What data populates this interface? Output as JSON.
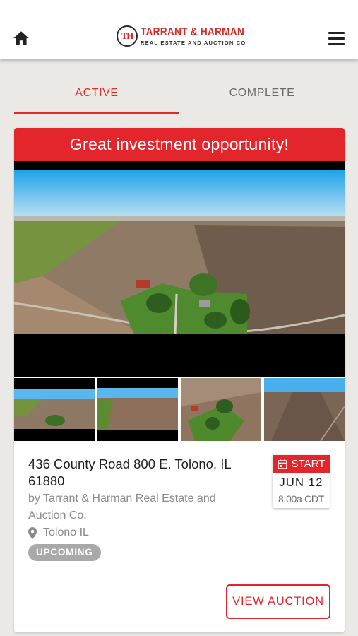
{
  "header": {
    "logo": {
      "monogram": "TH",
      "name": "TARRANT & HARMAN",
      "tagline": "REAL ESTATE AND AUCTION CO"
    },
    "icons": {
      "home": "home-icon",
      "menu": "hamburger-menu-icon"
    }
  },
  "tabs": [
    {
      "label": "ACTIVE",
      "selected": true
    },
    {
      "label": "COMPLETE",
      "selected": false
    }
  ],
  "listing": {
    "banner": "Great investment opportunity!",
    "address": "436 County Road 800 E. Tolono, IL 61880",
    "byline": "by Tarrant & Harman Real Estate and Auction Co.",
    "location": "Tolono IL",
    "status": "UPCOMING",
    "start": {
      "label": "START",
      "date": "JUN 12",
      "time": "8:00a CDT"
    },
    "cta": "VIEW AUCTION",
    "thumbnail_count": 4
  },
  "colors": {
    "accent": "#e3262b",
    "badge": "#a9a9a9",
    "background": "#ebe9e6"
  }
}
